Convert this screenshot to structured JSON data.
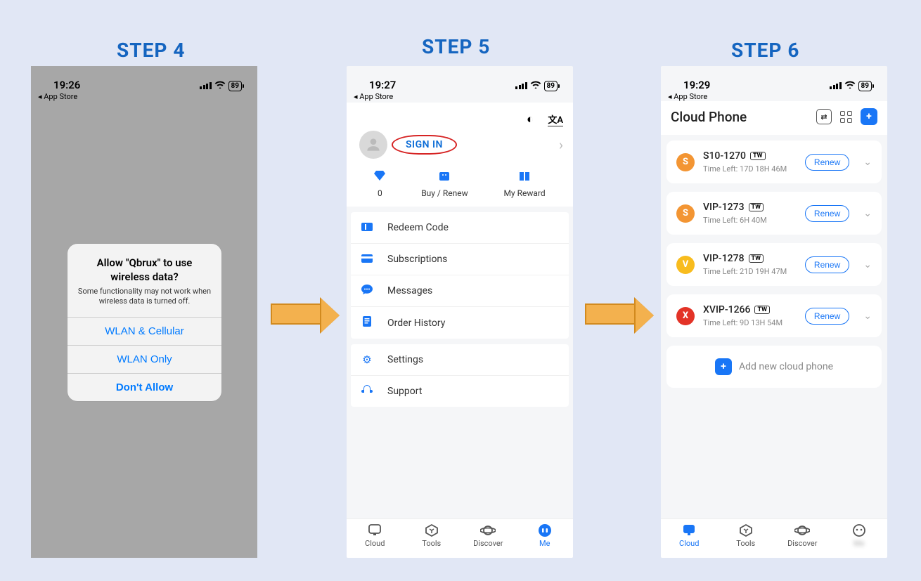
{
  "steps": {
    "s4": "STEP 4",
    "s5": "STEP 5",
    "s6": "STEP 6"
  },
  "status": {
    "s4_time": "19:26",
    "s5_time": "19:27",
    "s6_time": "19:29",
    "back": "◂ App Store",
    "battery": "89"
  },
  "dialog": {
    "title": "Allow \"Qbrux\" to use wireless data?",
    "subtitle": "Some functionality may not work when wireless data is turned off.",
    "opt1": "WLAN & Cellular",
    "opt2": "WLAN Only",
    "opt3": "Don't Allow"
  },
  "signin": {
    "label": "SIGN IN"
  },
  "quick": {
    "diamond_count": "0",
    "buy": "Buy / Renew",
    "reward": "My Reward"
  },
  "menu": {
    "redeem": "Redeem Code",
    "subs": "Subscriptions",
    "msgs": "Messages",
    "order": "Order History",
    "settings": "Settings",
    "support": "Support"
  },
  "tabs": {
    "cloud": "Cloud",
    "tools": "Tools",
    "discover": "Discover",
    "me": "Me"
  },
  "p6": {
    "title": "Cloud Phone",
    "time_label": "Time Left:",
    "renew": "Renew",
    "add": "Add new cloud phone",
    "devices": [
      {
        "badge": "S",
        "color": "bg-orange",
        "name": "S10-1270",
        "tag": "TW",
        "time": "17D  18H  46M"
      },
      {
        "badge": "S",
        "color": "bg-orange",
        "name": "VIP-1273",
        "tag": "TW",
        "time": "6H  40M"
      },
      {
        "badge": "V",
        "color": "bg-yellow",
        "name": "VIP-1278",
        "tag": "TW",
        "time": "21D  19H  47M"
      },
      {
        "badge": "X",
        "color": "bg-red",
        "name": "XVIP-1266",
        "tag": "TW",
        "time": "9D  13H  54M"
      }
    ]
  }
}
